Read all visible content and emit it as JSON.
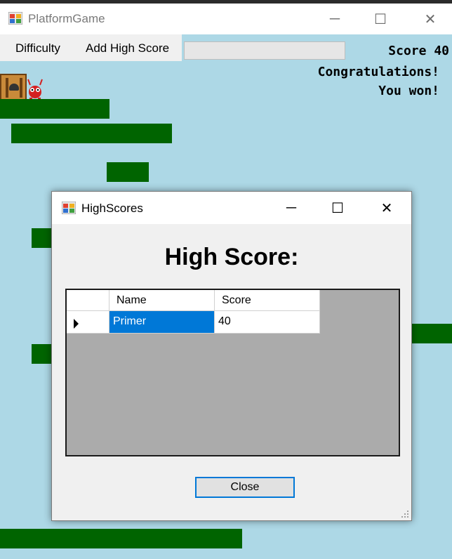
{
  "window": {
    "title": "PlatformGame",
    "app_icon": "windows-form-icon",
    "minimize_glyph": "─",
    "maximize_glyph": "☐",
    "close_glyph": "✕"
  },
  "menu": {
    "items": [
      {
        "label": "Difficulty"
      },
      {
        "label": "Add High Score"
      }
    ],
    "name_input_value": ""
  },
  "hud": {
    "score": "Score 40",
    "congrats_line1": "Congratulations!",
    "congrats_line2": "You won!"
  },
  "dialog": {
    "title": "HighScores",
    "icon": "windows-form-icon",
    "minimize_glyph": "─",
    "maximize_glyph": "☐",
    "close_glyph": "✕",
    "heading": "High Score:",
    "table": {
      "columns": [
        "Name",
        "Score"
      ],
      "rows": [
        {
          "name": "Primer",
          "score": "40"
        }
      ]
    },
    "close_label": "Close"
  },
  "colors": {
    "game_background": "#add8e6",
    "platform": "#006400",
    "selection": "#0078d7"
  }
}
